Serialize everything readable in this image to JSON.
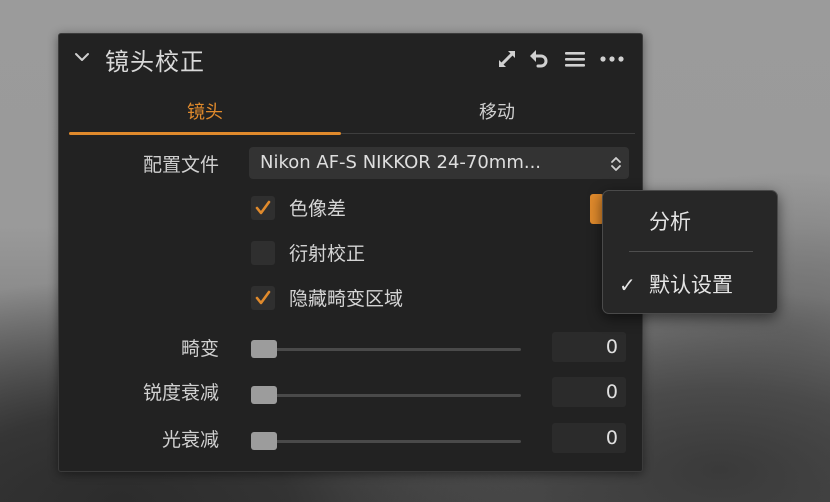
{
  "panel": {
    "title": "镜头校正",
    "tabs": [
      {
        "label": "镜头",
        "active": true
      },
      {
        "label": "移动",
        "active": false
      }
    ],
    "profile": {
      "label": "配置文件",
      "value": "Nikon AF-S NIKKOR 24-70mm..."
    },
    "checkboxes": [
      {
        "label": "色像差",
        "checked": true
      },
      {
        "label": "衍射校正",
        "checked": false
      },
      {
        "label": "隐藏畸变区域",
        "checked": true
      }
    ],
    "sliders": [
      {
        "label": "畸变",
        "value": "0",
        "level": 0
      },
      {
        "label": "锐度衰减",
        "value": "0",
        "level": 0
      },
      {
        "label": "光衰减",
        "value": "0",
        "level": 0
      }
    ],
    "header_icons": [
      "expand-icon",
      "reset-icon",
      "list-icon",
      "more-icon"
    ]
  },
  "popup_menu": {
    "items": [
      {
        "label": "分析",
        "checked": false
      },
      {
        "label": "默认设置",
        "checked": true
      }
    ]
  },
  "colors": {
    "accent": "#e08a2c",
    "panel_bg": "#222222",
    "field_bg": "#333333"
  }
}
